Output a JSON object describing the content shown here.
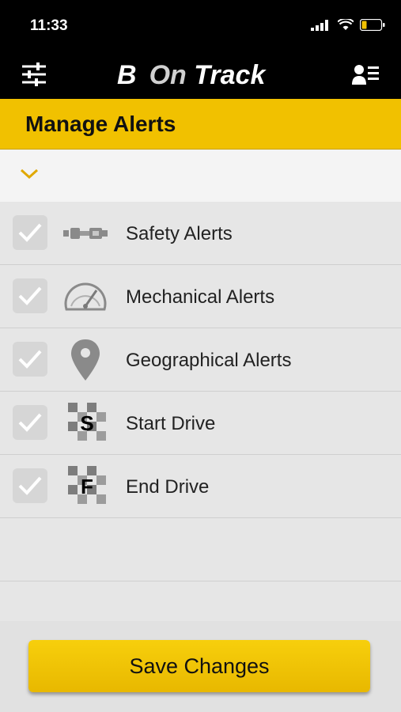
{
  "status_bar": {
    "time": "11:33"
  },
  "app_bar": {
    "logo_b": "B",
    "logo_on": "On",
    "logo_track": "Track",
    "menu_icon": "sliders-icon",
    "profile_icon": "profile-list-icon"
  },
  "page": {
    "title": "Manage Alerts"
  },
  "alerts": [
    {
      "label": "Safety Alerts",
      "checked": true,
      "icon": "seatbelt-icon"
    },
    {
      "label": "Mechanical Alerts",
      "checked": true,
      "icon": "speedometer-icon"
    },
    {
      "label": "Geographical Alerts",
      "checked": true,
      "icon": "location-pin-icon"
    },
    {
      "label": "Start Drive",
      "checked": true,
      "icon": "start-flag-icon",
      "icon_letter": "S"
    },
    {
      "label": "End Drive",
      "checked": true,
      "icon": "end-flag-icon",
      "icon_letter": "F"
    }
  ],
  "footer": {
    "save_label": "Save Changes"
  },
  "colors": {
    "accent": "#f1c100",
    "header_bg": "#000000",
    "list_bg": "#e6e6e6"
  }
}
